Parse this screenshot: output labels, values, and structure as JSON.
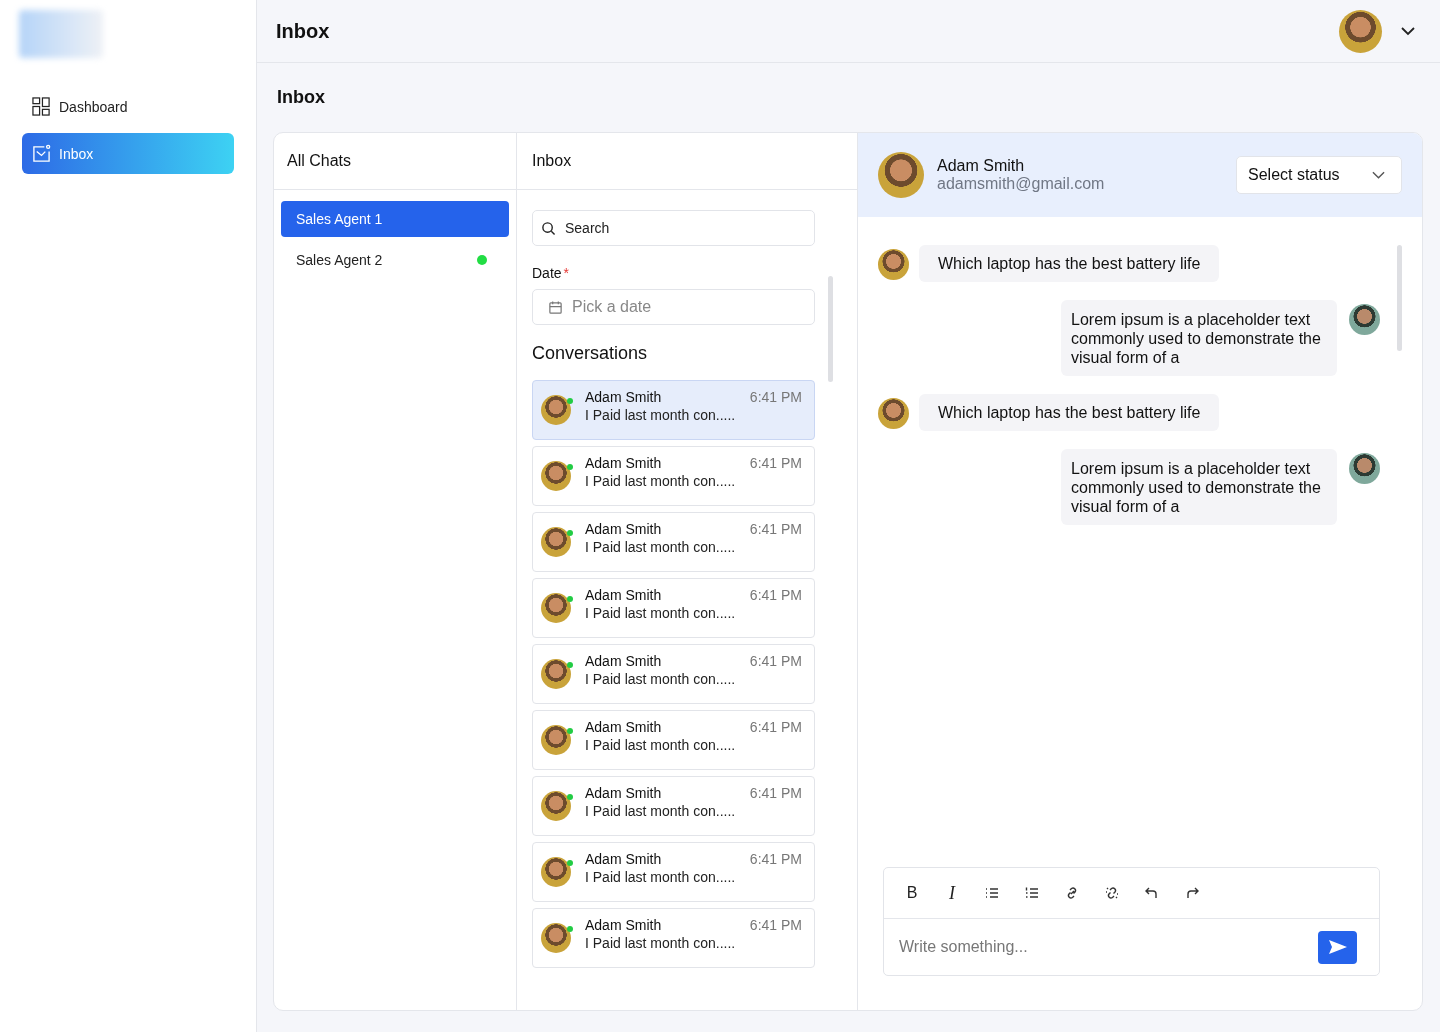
{
  "sidebar": {
    "items": [
      {
        "label": "Dashboard",
        "kind": "grid",
        "selected": false
      },
      {
        "label": "Inbox",
        "kind": "mail",
        "selected": true
      }
    ]
  },
  "header": {
    "title": "Inbox"
  },
  "page_title": "Inbox",
  "chats": {
    "title": "All Chats",
    "agents": [
      {
        "name": "Sales Agent 1",
        "selected": true,
        "online": false
      },
      {
        "name": "Sales Agent 2",
        "selected": false,
        "online": true
      }
    ]
  },
  "inbox": {
    "title": "Inbox",
    "search": {
      "placeholder": "Search"
    },
    "date": {
      "label": "Date",
      "required_mark": "*",
      "placeholder": "Pick a date"
    },
    "conversations_title": "Conversations",
    "conversations": [
      {
        "name": "Adam Smith",
        "time": "6:41 PM",
        "preview": "I Paid last month con.....",
        "selected": true,
        "online": true
      },
      {
        "name": "Adam Smith",
        "time": "6:41 PM",
        "preview": "I Paid last month con.....",
        "selected": false,
        "online": true
      },
      {
        "name": "Adam Smith",
        "time": "6:41 PM",
        "preview": "I Paid last month con.....",
        "selected": false,
        "online": true
      },
      {
        "name": "Adam Smith",
        "time": "6:41 PM",
        "preview": "I Paid last month con.....",
        "selected": false,
        "online": true
      },
      {
        "name": "Adam Smith",
        "time": "6:41 PM",
        "preview": "I Paid last month con.....",
        "selected": false,
        "online": true
      },
      {
        "name": "Adam Smith",
        "time": "6:41 PM",
        "preview": "I Paid last month con.....",
        "selected": false,
        "online": true
      },
      {
        "name": "Adam Smith",
        "time": "6:41 PM",
        "preview": "I Paid last month con.....",
        "selected": false,
        "online": true
      },
      {
        "name": "Adam Smith",
        "time": "6:41 PM",
        "preview": "I Paid last month con.....",
        "selected": false,
        "online": true
      },
      {
        "name": "Adam Smith",
        "time": "6:41 PM",
        "preview": "I Paid last month con.....",
        "selected": false,
        "online": true
      }
    ]
  },
  "chat": {
    "contact": {
      "name": "Adam Smith",
      "email": "adamsmith@gmail.com"
    },
    "status_select": {
      "placeholder": "Select status"
    },
    "messages": [
      {
        "kind": "incoming",
        "text": "Which laptop has the best battery life"
      },
      {
        "kind": "outgoing",
        "text": "Lorem ipsum is a placeholder text commonly used to demonstrate the visual form of a"
      },
      {
        "kind": "incoming",
        "text": "Which laptop has the best battery life"
      },
      {
        "kind": "outgoing",
        "text": "Lorem ipsum is a placeholder text commonly used to demonstrate the visual form of a"
      }
    ],
    "editor": {
      "toolbar": [
        {
          "kind": "bold",
          "label": "B"
        },
        {
          "kind": "italic",
          "label": "I"
        },
        {
          "kind": "bullet-list"
        },
        {
          "kind": "numbered-list"
        },
        {
          "kind": "link"
        },
        {
          "kind": "unlink"
        },
        {
          "kind": "undo"
        },
        {
          "kind": "redo"
        }
      ],
      "placeholder": "Write something..."
    }
  }
}
